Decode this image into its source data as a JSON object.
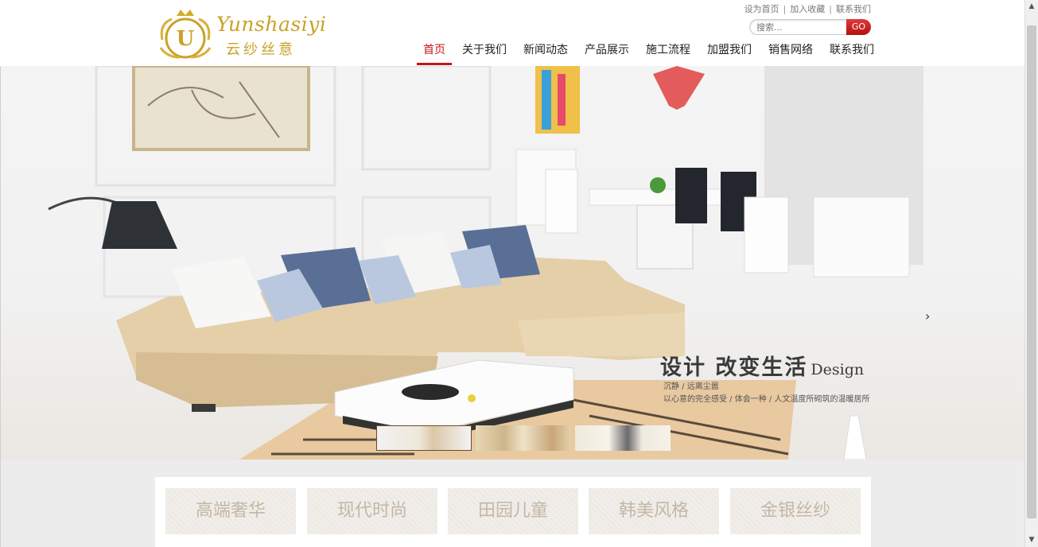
{
  "brand": {
    "logo_script": "Yunshasiyi",
    "logo_cn": "云纱丝意",
    "logo_letter": "U"
  },
  "toplinks": [
    "设为首页",
    "加入收藏",
    "联系我们"
  ],
  "toplink_separator": "|",
  "search": {
    "placeholder": "搜索...",
    "button": "GO"
  },
  "nav": [
    {
      "label": "首页",
      "active": true
    },
    {
      "label": "关于我们",
      "active": false
    },
    {
      "label": "新闻动态",
      "active": false
    },
    {
      "label": "产品展示",
      "active": false
    },
    {
      "label": "施工流程",
      "active": false
    },
    {
      "label": "加盟我们",
      "active": false
    },
    {
      "label": "销售网络",
      "active": false
    },
    {
      "label": "联系我们",
      "active": false
    }
  ],
  "hero": {
    "headline": "设计 改变生活",
    "headline_en": "Design",
    "sub1": "沉静 / 远离尘嚣",
    "sub2": "以心意的完全感受 / 体会一种 / 人文温度所砌筑的温暖居所",
    "next_arrow": "›",
    "slide_count": 3,
    "active_slide": 1
  },
  "categories": [
    "高端奢华",
    "现代时尚",
    "田园儿童",
    "韩美风格",
    "金银丝纱"
  ],
  "colors": {
    "accent": "#c8141a",
    "gold": "#c9a227",
    "category_text": "#c4b7a6"
  },
  "scrollbar": {
    "up": "▲",
    "down": "▼"
  }
}
